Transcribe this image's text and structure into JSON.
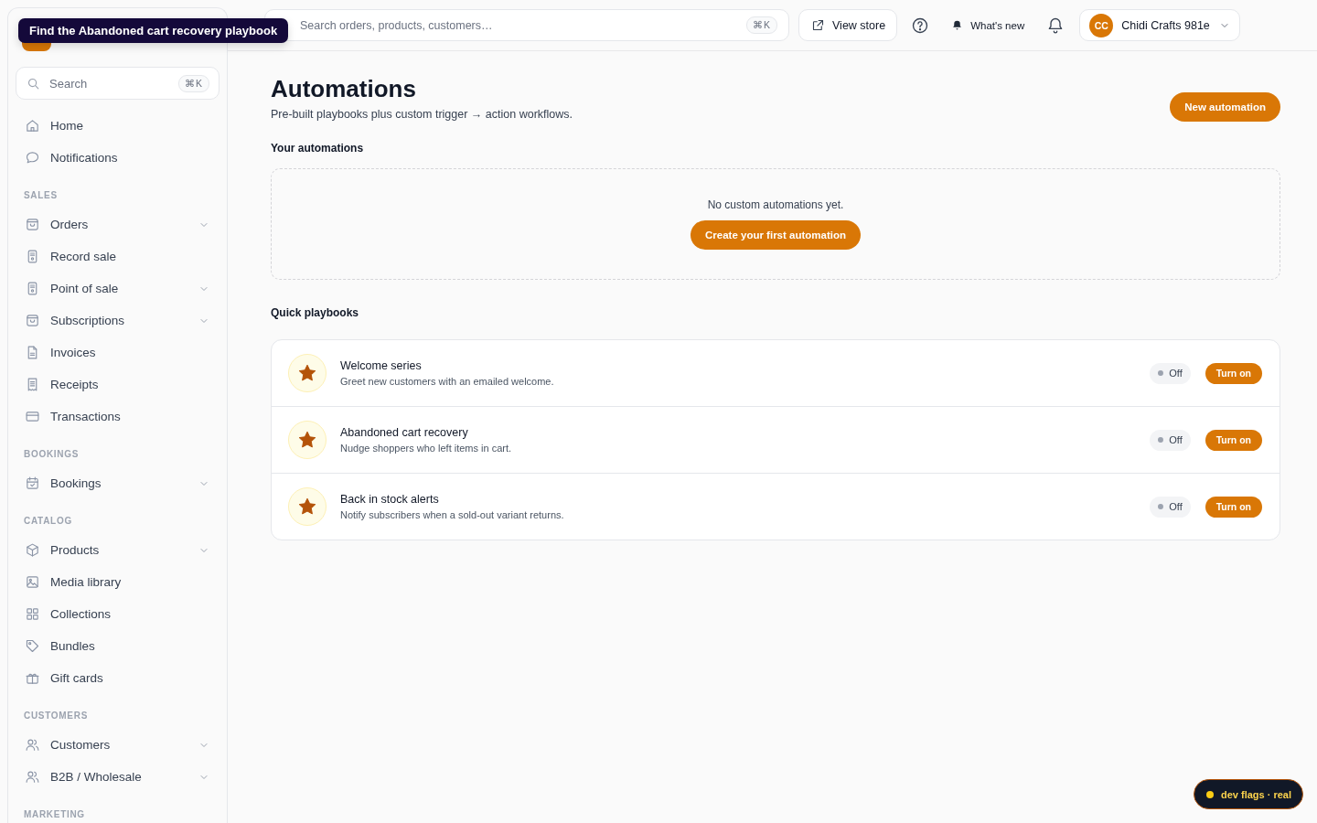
{
  "tooltip": {
    "text": "Find the Abandoned cart recovery playbook"
  },
  "sidebar": {
    "search": {
      "placeholder": "Search",
      "shortcut": "⌘K"
    },
    "groups": [
      {
        "items": [
          {
            "label": "Home",
            "expandable": false,
            "selected": false
          },
          {
            "label": "Notifications",
            "expandable": false,
            "selected": false
          }
        ]
      },
      {
        "heading": "SALES",
        "items": [
          {
            "label": "Orders",
            "expandable": true,
            "selected": false
          },
          {
            "label": "Record sale",
            "expandable": false,
            "selected": false
          },
          {
            "label": "Point of sale",
            "expandable": true,
            "selected": false
          },
          {
            "label": "Subscriptions",
            "expandable": true,
            "selected": false
          },
          {
            "label": "Invoices",
            "expandable": false,
            "selected": false
          },
          {
            "label": "Receipts",
            "expandable": false,
            "selected": false
          },
          {
            "label": "Transactions",
            "expandable": false,
            "selected": false
          }
        ]
      },
      {
        "heading": "BOOKINGS",
        "items": [
          {
            "label": "Bookings",
            "expandable": true,
            "selected": false
          }
        ]
      },
      {
        "heading": "CATALOG",
        "items": [
          {
            "label": "Products",
            "expandable": true,
            "selected": false
          },
          {
            "label": "Media library",
            "expandable": false,
            "selected": false
          },
          {
            "label": "Collections",
            "expandable": false,
            "selected": false
          },
          {
            "label": "Bundles",
            "expandable": false,
            "selected": false
          },
          {
            "label": "Gift cards",
            "expandable": false,
            "selected": false
          }
        ]
      },
      {
        "heading": "CUSTOMERS",
        "items": [
          {
            "label": "Customers",
            "expandable": true,
            "selected": false
          },
          {
            "label": "B2B / Wholesale",
            "expandable": true,
            "selected": false
          }
        ]
      },
      {
        "heading": "MARKETING"
      }
    ]
  },
  "topbar": {
    "search": {
      "placeholder": "Search orders, products, customers…",
      "shortcut": "⌘K"
    },
    "view_store": "View store",
    "whats_new": "What's new",
    "account": {
      "initials": "CC",
      "name": "Chidi Crafts 981e"
    }
  },
  "page": {
    "title": "Automations",
    "subtitle": "Pre-built playbooks plus custom trigger → action workflows.",
    "new_button": "New automation",
    "your_automations": {
      "heading": "Your automations",
      "empty_text": "No custom automations yet.",
      "create_button": "Create your first automation"
    },
    "quick_playbooks": {
      "heading": "Quick playbooks",
      "items": [
        {
          "title": "Welcome series",
          "description": "Greet new customers with an emailed welcome.",
          "enabled": false,
          "status": "Off",
          "action": "Turn on"
        },
        {
          "title": "Abandoned cart recovery",
          "description": "Nudge shoppers who left items in cart.",
          "enabled": false,
          "status": "Off",
          "action": "Turn on"
        },
        {
          "title": "Back in stock alerts",
          "description": "Notify subscribers when a sold-out variant returns.",
          "enabled": false,
          "status": "Off",
          "action": "Turn on"
        }
      ]
    }
  },
  "dev_badge": {
    "text": "dev flags · real"
  }
}
